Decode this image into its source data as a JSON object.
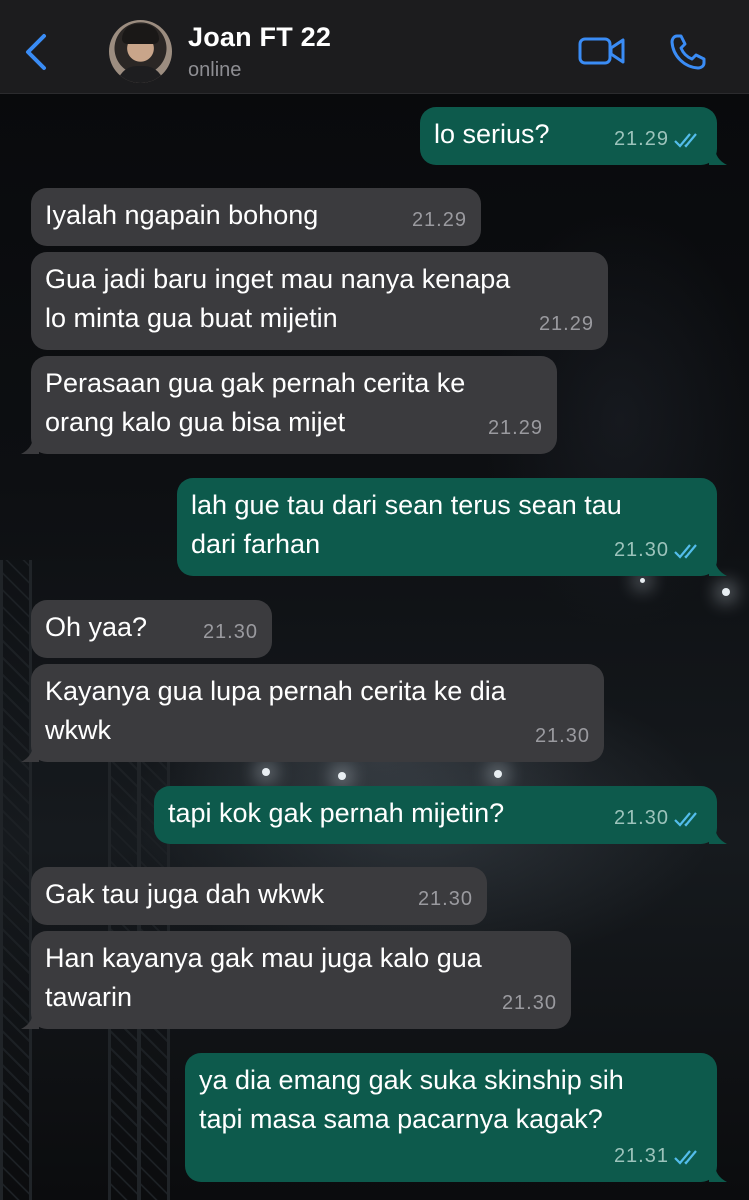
{
  "header": {
    "back_icon": "chevron-left-icon",
    "contact_name": "Joan FT 22",
    "status": "online",
    "video_icon": "video-camera-icon",
    "call_icon": "phone-icon"
  },
  "colors": {
    "accent": "#3a8cf5",
    "incoming_bubble": "#3b3b3e",
    "outgoing_bubble": "#0d5a4c",
    "read_ticks": "#53bdeb"
  },
  "messages": [
    {
      "direction": "outgoing",
      "text": "lo serius?",
      "time": "21.29",
      "status": "read"
    },
    {
      "direction": "incoming",
      "text": "Iyalah ngapain bohong",
      "time": "21.29"
    },
    {
      "direction": "incoming",
      "text": "Gua jadi baru inget mau nanya kenapa\nlo minta gua buat mijetin",
      "time": "21.29"
    },
    {
      "direction": "incoming",
      "text": "Perasaan gua gak pernah cerita ke\norang kalo gua bisa mijet",
      "time": "21.29"
    },
    {
      "direction": "outgoing",
      "text": "lah gue tau dari sean terus sean tau\ndari farhan",
      "time": "21.30",
      "status": "read"
    },
    {
      "direction": "incoming",
      "text": "Oh yaa?",
      "time": "21.30"
    },
    {
      "direction": "incoming",
      "text": "Kayanya gua lupa pernah cerita ke dia\nwkwk",
      "time": "21.30"
    },
    {
      "direction": "outgoing",
      "text": "tapi kok gak pernah mijetin?",
      "time": "21.30",
      "status": "read"
    },
    {
      "direction": "incoming",
      "text": "Gak tau juga dah wkwk",
      "time": "21.30"
    },
    {
      "direction": "incoming",
      "text": "Han kayanya gak mau juga kalo gua\ntawarin",
      "time": "21.30"
    },
    {
      "direction": "outgoing",
      "text": "ya dia emang gak suka skinship sih\ntapi masa sama pacarnya kagak?",
      "time": "21.31",
      "status": "read"
    }
  ]
}
